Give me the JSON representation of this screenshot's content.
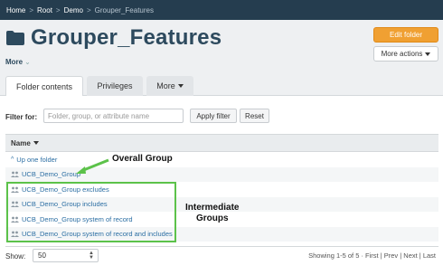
{
  "breadcrumb": {
    "items": [
      "Home",
      "Root",
      "Demo",
      "Grouper_Features"
    ],
    "separator": ">"
  },
  "title": "Grouper_Features",
  "more_link": "More",
  "buttons": {
    "edit_folder": "Edit folder",
    "more_actions": "More actions"
  },
  "tabs": [
    {
      "label": "Folder contents",
      "active": true
    },
    {
      "label": "Privileges",
      "active": false
    },
    {
      "label": "More",
      "active": false
    }
  ],
  "filter": {
    "label": "Filter for:",
    "placeholder": "Folder, group, or attribute name",
    "apply_label": "Apply filter",
    "reset_label": "Reset"
  },
  "table": {
    "header": "Name",
    "up_one": "Up one folder",
    "rows": [
      "UCB_Demo_Group",
      "UCB_Demo_Group excludes",
      "UCB_Demo_Group includes",
      "UCB_Demo_Group system of record",
      "UCB_Demo_Group system of record and includes"
    ]
  },
  "pagination": {
    "show_label": "Show:",
    "page_size": "50",
    "summary": "Showing 1-5 of 5 · First | Prev | Next | Last"
  },
  "annotations": {
    "overall": "Overall Group",
    "intermediate_line1": "Intermediate",
    "intermediate_line2": "Groups"
  },
  "colors": {
    "brand": "#253d4f",
    "accent": "#f0a032",
    "highlight": "#5cc24a",
    "link": "#2b6ea3"
  }
}
